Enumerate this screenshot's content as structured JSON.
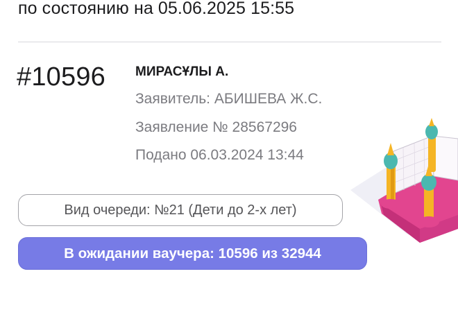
{
  "header": {
    "status_text": "по состоянию на 05.06.2025 15:55"
  },
  "card": {
    "queue_number": "#10596",
    "child_name": "МИРАСҰЛЫ А.",
    "applicant": "Заявитель: АБИШЕВА Ж.С.",
    "application": "Заявление № 28567296",
    "submitted": "Подано 06.03.2024 13:44",
    "queue_type": "Вид очереди: №21 (Дети до 2-х лет)",
    "voucher_status": "В ожидании ваучера: 10596 из 32944"
  },
  "colors": {
    "accent": "#777be6",
    "muted_text": "#7b7b80"
  },
  "icons": {
    "illustration": "bouncy-castle-illustration"
  }
}
